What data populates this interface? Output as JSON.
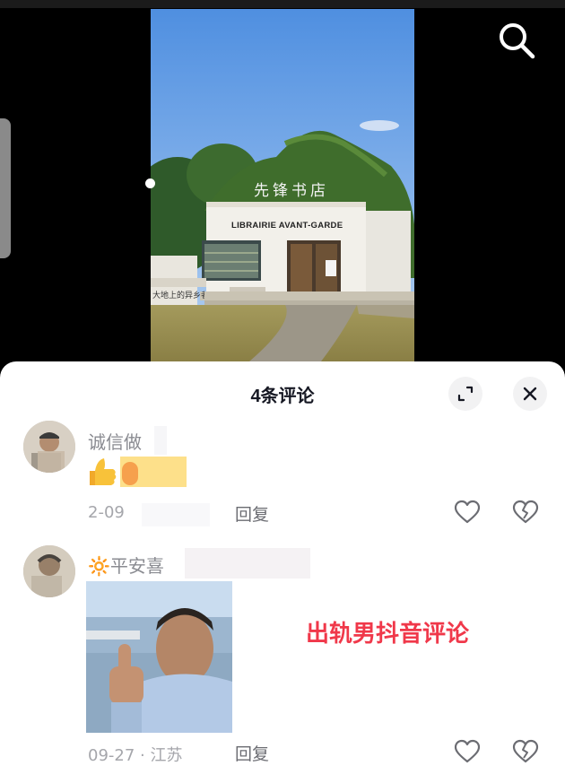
{
  "video": {
    "store_sign_en": "LIBRAIRIE AVANT-GARDE",
    "store_sign_cn": "先锋书店",
    "rock_text": "大地上的异乡者"
  },
  "sheet": {
    "title": "4条评论",
    "overlay_caption": "出轨男抖音评论"
  },
  "comments": [
    {
      "username": "诚信做",
      "date": "2-09",
      "reply_label": "回复"
    },
    {
      "username": "🔆平安喜",
      "date": "09-27",
      "location": "江苏",
      "reply_label": "回复"
    }
  ],
  "icons": {
    "search": "search-icon",
    "expand": "expand-icon",
    "close": "close-icon",
    "like": "heart-icon",
    "dislike": "broken-heart-icon"
  },
  "colors": {
    "accent_text": "#f0384a",
    "muted_text": "#8a8b91",
    "title_text": "#161823"
  }
}
